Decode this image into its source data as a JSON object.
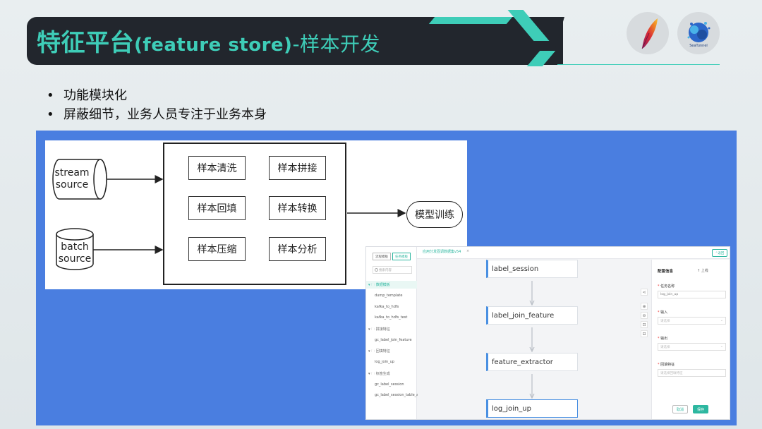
{
  "header": {
    "title_cn": "特征平台",
    "title_en": "(feature store)",
    "title_tail": "-样本开发",
    "logo_apache": "apache-feather-logo",
    "logo_seatunnel": "SeaTunnel"
  },
  "bullets": [
    "功能模块化",
    "屏蔽细节，业务人员专注于业务本身"
  ],
  "diagram": {
    "sources": [
      "stream\nsource",
      "batch\nsource"
    ],
    "stream_source_l1": "stream",
    "stream_source_l2": "source",
    "batch_source_l1": "batch",
    "batch_source_l2": "source",
    "steps": [
      "样本清洗",
      "样本拼接",
      "样本回填",
      "样本转换",
      "样本压缩",
      "样本分析"
    ],
    "output": "模型训练"
  },
  "app": {
    "mode_tabs": [
      "流程模板",
      "任务模板"
    ],
    "tab_title": "应用分发固调数据集v54",
    "tab_close": "×",
    "top_right_button": "⌃返回",
    "search_placeholder": "搜索内容",
    "tree": {
      "folder1": "数据模板",
      "f1_items": [
        "dump_template",
        "kafka_to_hdfs",
        "kafka_to_hdfs_test"
      ],
      "folder2": "拼接特征",
      "f2_items": [
        "gc_label_join_feature"
      ],
      "folder3": "回填特征",
      "f3_items": [
        "log_join_up"
      ],
      "folder4": "标签生成",
      "f4_items": [
        "gc_label_session",
        "gc_label_session_table_ap"
      ]
    },
    "nodes": [
      "label_session",
      "label_join_feature",
      "feature_extractor",
      "log_join_up"
    ],
    "tools": [
      "⋖",
      "⊕",
      "⊖",
      "⊡",
      "⊟"
    ],
    "config": {
      "title": "配置信息",
      "upload": "↑ 上线",
      "task_name_label": "任务名称",
      "task_name_value": "log_join_up",
      "input_label": "输入",
      "input_placeholder": "请选择",
      "output_label": "输出",
      "output_placeholder": "请选择",
      "feature_label": "回填特征",
      "feature_placeholder": "请选择回填特征",
      "cancel": "取消",
      "save": "保存"
    }
  },
  "colors": {
    "teal": "#3ecdb8",
    "dark": "#22262d",
    "blue_panel": "#4a7ee0",
    "node_accent": "#4a90e2",
    "app_accent": "#2db7a0"
  }
}
